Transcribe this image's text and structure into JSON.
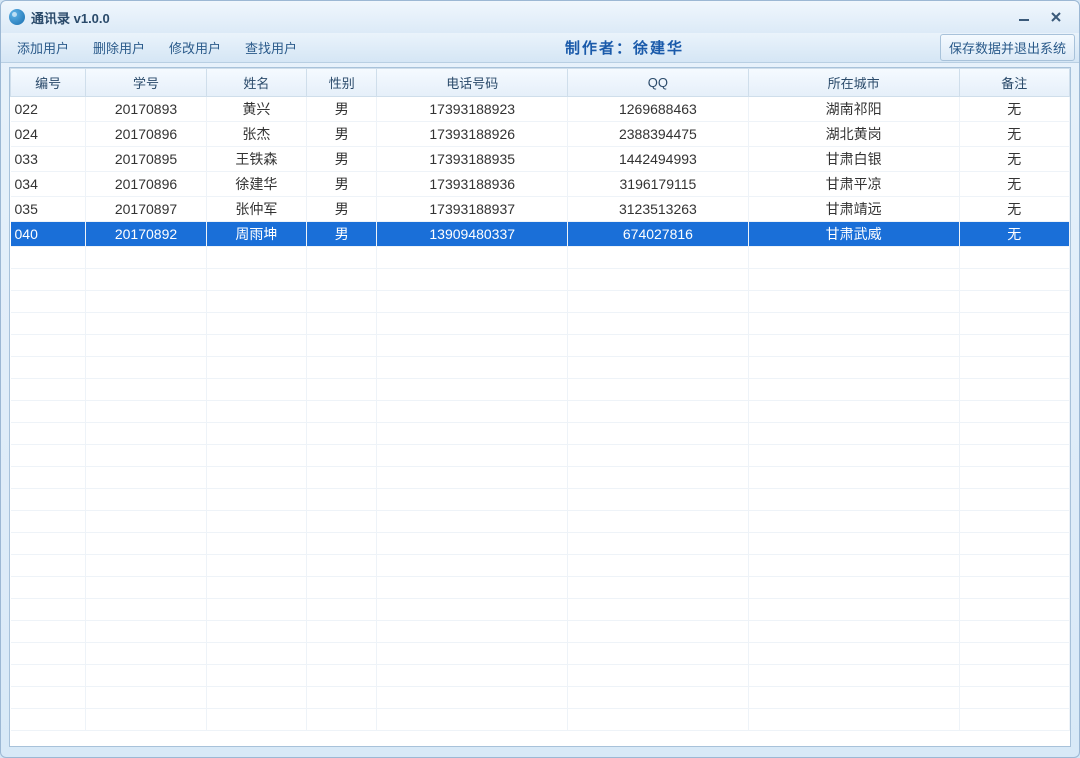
{
  "window": {
    "title": "通讯录  v1.0.0"
  },
  "toolbar": {
    "add_user": "添加用户",
    "delete_user": "删除用户",
    "modify_user": "修改用户",
    "find_user": "查找用户",
    "author_label": "制作者：徐建华",
    "save_exit": "保存数据并退出系统"
  },
  "table": {
    "headers": [
      "编号",
      "学号",
      "姓名",
      "性别",
      "电话号码",
      "QQ",
      "所在城市",
      "备注"
    ],
    "rows": [
      {
        "id": "022",
        "sid": "20170893",
        "name": "黄兴",
        "gender": "男",
        "phone": "17393188923",
        "qq": "1269688463",
        "city": "湖南祁阳",
        "note": "无",
        "selected": false
      },
      {
        "id": "024",
        "sid": "20170896",
        "name": "张杰",
        "gender": "男",
        "phone": "17393188926",
        "qq": "2388394475",
        "city": "湖北黄岗",
        "note": "无",
        "selected": false
      },
      {
        "id": "033",
        "sid": "20170895",
        "name": "王铁森",
        "gender": "男",
        "phone": "17393188935",
        "qq": "1442494993",
        "city": "甘肃白银",
        "note": "无",
        "selected": false
      },
      {
        "id": "034",
        "sid": "20170896",
        "name": "徐建华",
        "gender": "男",
        "phone": "17393188936",
        "qq": "3196179115",
        "city": "甘肃平凉",
        "note": "无",
        "selected": false
      },
      {
        "id": "035",
        "sid": "20170897",
        "name": "张仲军",
        "gender": "男",
        "phone": "17393188937",
        "qq": "3123513263",
        "city": "甘肃靖远",
        "note": "无",
        "selected": false
      },
      {
        "id": "040",
        "sid": "20170892",
        "name": "周雨坤",
        "gender": "男",
        "phone": "13909480337",
        "qq": "674027816",
        "city": "甘肃武威",
        "note": "无",
        "selected": true
      }
    ],
    "selected_index": 5
  }
}
